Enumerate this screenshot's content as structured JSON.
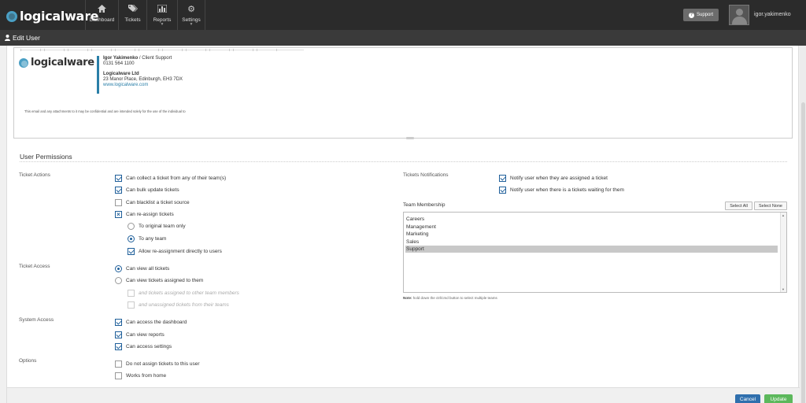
{
  "app": {
    "logo_text": "logicalware"
  },
  "nav": {
    "items": [
      {
        "label": "Dashboard",
        "icon": "home-icon"
      },
      {
        "label": "Tickets",
        "icon": "tags-icon"
      },
      {
        "label": "Reports",
        "icon": "bar-chart-icon"
      },
      {
        "label": "Settings",
        "icon": "gear-icon"
      }
    ],
    "support_label": "Support",
    "username": "igor.yakimenko"
  },
  "page": {
    "title": "Edit User"
  },
  "signature": {
    "logo_text": "logicalware",
    "name": "Igor Yakimenko",
    "role": " / Client Support",
    "phone": "0131 564 1100",
    "company": "Logicalware Ltd",
    "address": "23 Manor Place, Edinburgh, EH3 7DX",
    "website": "www.logicalware.com",
    "disclaimer": "This email and any attachments to it may be confidential and are intended solely for the use of the individual to"
  },
  "permissions": {
    "title": "User Permissions",
    "ticket_actions": {
      "label": "Ticket Actions",
      "items": [
        {
          "label": "Can collect a ticket from any of their team(s)",
          "state": "checked"
        },
        {
          "label": "Can bulk update tickets",
          "state": "checked"
        },
        {
          "label": "Can blacklist a ticket source",
          "state": "unchecked"
        },
        {
          "label": "Can re-assign tickets",
          "state": "crossed"
        }
      ],
      "reassign_options": [
        {
          "label": "To original team only",
          "selected": false
        },
        {
          "label": "To any team",
          "selected": true
        }
      ],
      "allow_direct": {
        "label": "Allow re-assignment directly to users",
        "state": "checked"
      }
    },
    "ticket_access": {
      "label": "Ticket Access",
      "options": [
        {
          "label": "Can view all tickets",
          "selected": true
        },
        {
          "label": "Can view tickets assigned to them",
          "selected": false
        }
      ],
      "sub_items": [
        {
          "label": "and tickets assigned to other team members"
        },
        {
          "label": "and unassigned tickets from their teams"
        }
      ]
    },
    "system_access": {
      "label": "System Access",
      "items": [
        {
          "label": "Can access the dashboard",
          "state": "checked"
        },
        {
          "label": "Can view reports",
          "state": "checked"
        },
        {
          "label": "Can access settings",
          "state": "checked"
        }
      ]
    },
    "options": {
      "label": "Options",
      "items": [
        {
          "label": "Do not assign tickets to this user",
          "state": "unchecked"
        },
        {
          "label": "Works from home",
          "state": "unchecked"
        }
      ]
    },
    "notifications": {
      "label": "Tickets Notifications",
      "items": [
        {
          "label": "Notify user when they are assigned a ticket",
          "state": "checked"
        },
        {
          "label": "Notify user when there is a tickets waiting for them",
          "state": "checked"
        }
      ]
    },
    "team_membership": {
      "label": "Team Membership",
      "select_all": "Select All",
      "select_none": "Select None",
      "teams": [
        {
          "name": "Careers",
          "selected": false
        },
        {
          "name": "Management",
          "selected": false
        },
        {
          "name": "Marketing",
          "selected": false
        },
        {
          "name": "Sales",
          "selected": false
        },
        {
          "name": "Support",
          "selected": true
        }
      ],
      "note_label": "Note:",
      "note_text": " hold down the ctrl/cmd button to select multiple teams"
    }
  },
  "footer": {
    "cancel_label": "Cancel",
    "update_label": "Update"
  },
  "colors": {
    "primary": "#2f6fad",
    "success": "#5cb85c",
    "nav_bg": "#2b2b2b",
    "accent_blue": "#2a7fa8"
  }
}
